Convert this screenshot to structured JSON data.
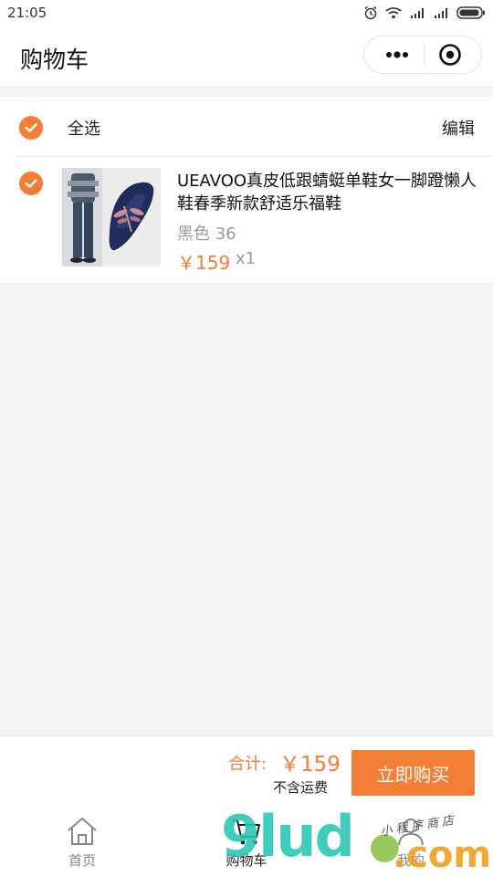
{
  "status_bar": {
    "time": "21:05",
    "icons": [
      "alarm-icon",
      "wifi-icon",
      "signal-icon",
      "signal-icon",
      "battery-icon"
    ]
  },
  "nav": {
    "title": "购物车",
    "more_icon": "more-dots-icon",
    "close_icon": "target-circle-icon"
  },
  "cart": {
    "select_all_label": "全选",
    "edit_label": "编辑",
    "items": [
      {
        "name": "UEAVOO真皮低跟蜻蜓单鞋女一脚蹬懒人鞋春季新款舒适乐福鞋",
        "spec": "黑色 36",
        "price": "￥159",
        "quantity": "x1",
        "checked": true
      }
    ]
  },
  "checkout": {
    "total_label": "合计:",
    "total_value": "￥159",
    "shipping_note": "不含运费",
    "buy_label": "立即购买"
  },
  "tabs": [
    {
      "label": "首页",
      "icon": "home-icon",
      "active": false
    },
    {
      "label": "购物车",
      "icon": "cart-icon",
      "active": true
    },
    {
      "label": "我的",
      "icon": "user-icon",
      "active": false
    }
  ],
  "watermark": {
    "brand": "9lud",
    "domain": ".com",
    "caption": "小程序商店"
  },
  "colors": {
    "accent": "#f57e36",
    "background": "#f4f4f4"
  }
}
